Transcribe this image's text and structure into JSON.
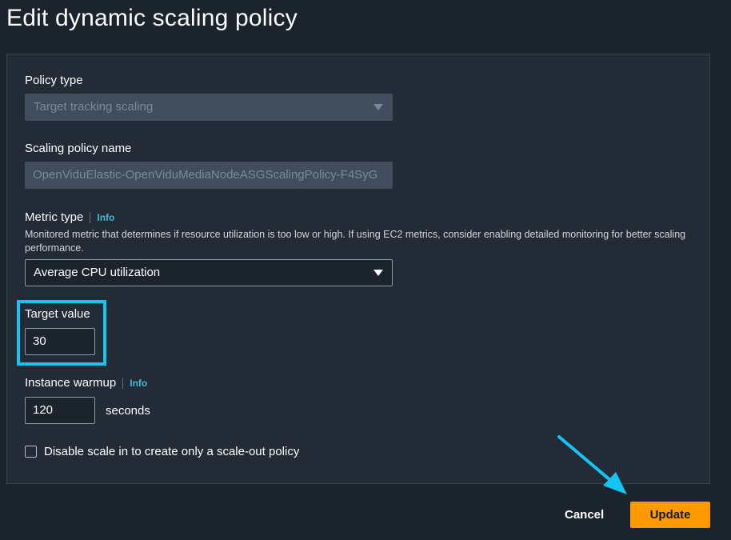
{
  "header": {
    "title": "Edit dynamic scaling policy"
  },
  "form": {
    "policy_type": {
      "label": "Policy type",
      "value": "Target tracking scaling"
    },
    "policy_name": {
      "label": "Scaling policy name",
      "value": "OpenViduElastic-OpenViduMediaNodeASGScalingPolicy-F4SyG"
    },
    "metric_type": {
      "label": "Metric type",
      "info": "Info",
      "description": "Monitored metric that determines if resource utilization is too low or high. If using EC2 metrics, consider enabling detailed monitoring for better scaling performance.",
      "value": "Average CPU utilization"
    },
    "target_value": {
      "label": "Target value",
      "value": "30"
    },
    "instance_warmup": {
      "label": "Instance warmup",
      "info": "Info",
      "value": "120",
      "unit": "seconds"
    },
    "disable_scale_in": {
      "label": "Disable scale in to create only a scale-out policy",
      "checked": false
    }
  },
  "footer": {
    "cancel_label": "Cancel",
    "update_label": "Update"
  },
  "colors": {
    "background": "#1b232d",
    "panel": "#232b37",
    "accent_primary": "#ff9900",
    "info_link": "#44b9d6",
    "annotation": "#15c4f0"
  },
  "icons": [
    "caret-down-icon",
    "annotation-arrow-icon"
  ]
}
